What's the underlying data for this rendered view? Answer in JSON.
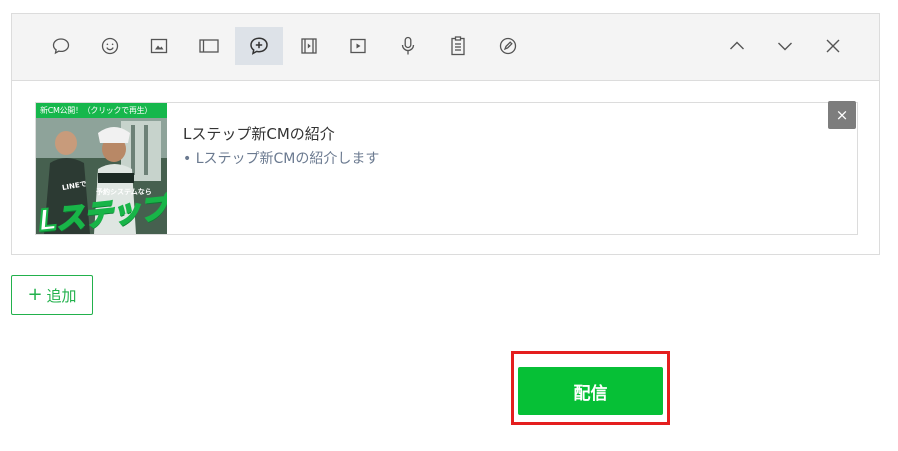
{
  "toolbar": {
    "tools": [
      {
        "icon": "speech-bubble-icon"
      },
      {
        "icon": "smiley-icon"
      },
      {
        "icon": "image-icon"
      },
      {
        "icon": "card-icon"
      },
      {
        "icon": "add-content-icon",
        "active": true
      },
      {
        "icon": "video-icon"
      },
      {
        "icon": "play-icon"
      },
      {
        "icon": "microphone-icon"
      },
      {
        "icon": "clipboard-icon"
      },
      {
        "icon": "edit-icon"
      }
    ],
    "controls": [
      "chevron-up-icon",
      "chevron-down-icon",
      "close-icon"
    ]
  },
  "card": {
    "thumbnail": {
      "banner": "新CM公開！（クリックで再生）",
      "line_text": "LINEで",
      "sub_text": "予約システムなら",
      "logo": "Lステップ"
    },
    "title": "Lステップ新CMの紹介",
    "description": "Lステップ新CMの紹介します",
    "remove_label": "×"
  },
  "add_button": {
    "plus": "+",
    "label": "追加"
  },
  "send_button": {
    "label": "配信"
  },
  "colors": {
    "accent_green": "#06c036",
    "outline_green": "#22b14c",
    "highlight_red": "#e41e1e",
    "toolbar_bg": "#f4f4f4",
    "active_tool_bg": "#dde2e8"
  }
}
